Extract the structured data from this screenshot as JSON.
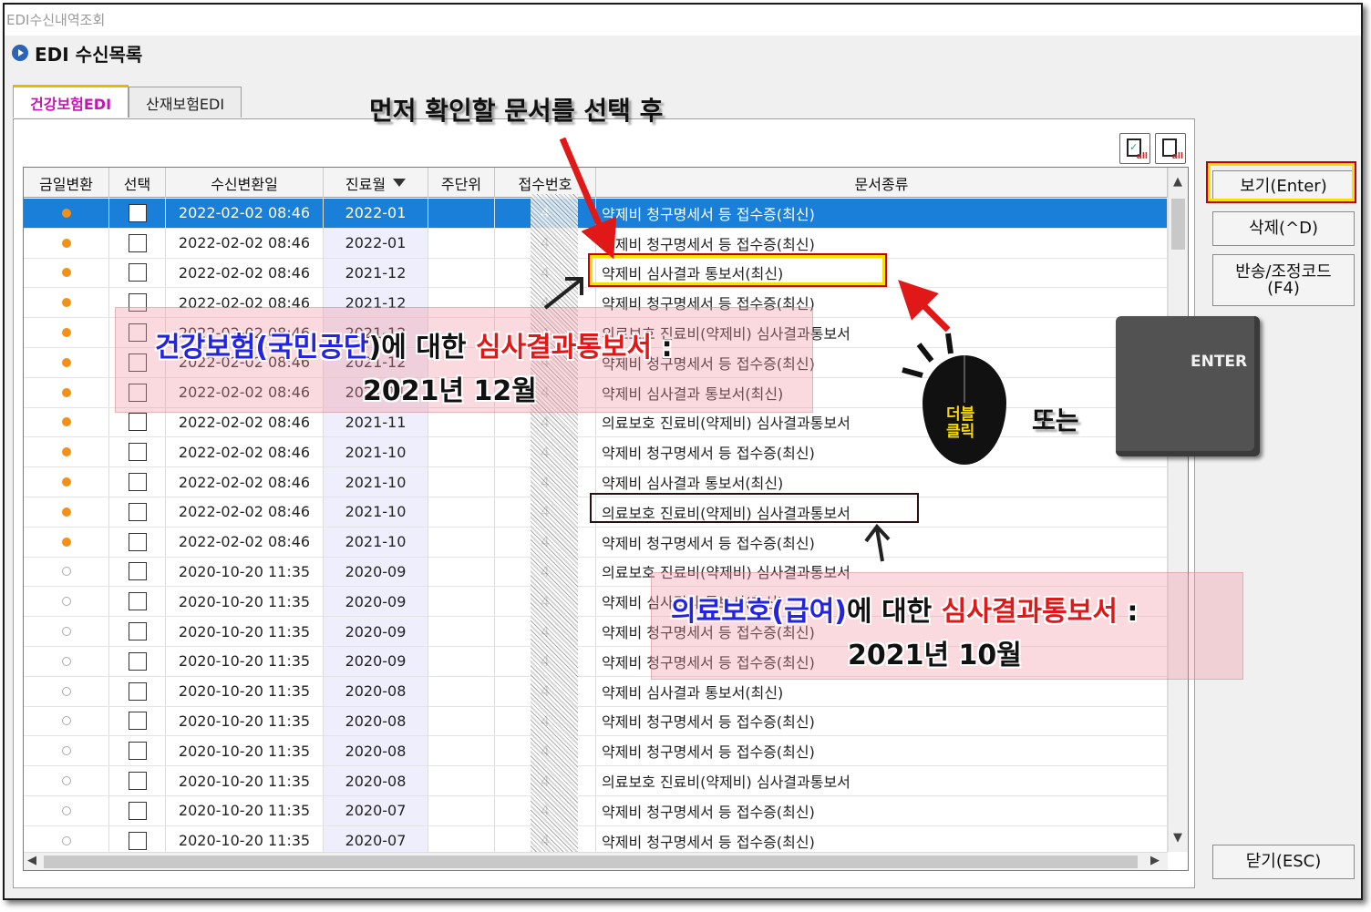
{
  "window": {
    "title": "EDI수신내역조회"
  },
  "section": {
    "title": "EDI 수신목록"
  },
  "tabs": [
    {
      "label": "건강보험EDI",
      "active": true
    },
    {
      "label": "산재보험EDI",
      "active": false
    }
  ],
  "toolbar_icons": [
    "select-all-icon",
    "deselect-all-icon"
  ],
  "grid": {
    "columns": [
      "금일변환",
      "선택",
      "수신변환일",
      "진료월",
      "주단위",
      "접수번호",
      "문서종류"
    ],
    "sort_column": "진료월",
    "rows": [
      {
        "today": true,
        "date": "2022-02-02 08:46",
        "month": "2022-01",
        "receipt": "4",
        "doc": "약제비 청구명세서 등 접수증(최신)"
      },
      {
        "today": true,
        "date": "2022-02-02 08:46",
        "month": "2022-01",
        "receipt": "4",
        "doc": "약제비 청구명세서 등 접수증(최신)"
      },
      {
        "today": true,
        "date": "2022-02-02 08:46",
        "month": "2021-12",
        "receipt": "4",
        "doc": "약제비 심사결과 통보서(최신)"
      },
      {
        "today": true,
        "date": "2022-02-02 08:46",
        "month": "2021-12",
        "receipt": "4",
        "doc": "약제비 청구명세서 등 접수증(최신)"
      },
      {
        "today": true,
        "date": "2022-02-02 08:46",
        "month": "2021-12",
        "receipt": "4",
        "doc": "의료보호 진료비(약제비) 심사결과통보서"
      },
      {
        "today": true,
        "date": "2022-02-02 08:46",
        "month": "2021-12",
        "receipt": "4",
        "doc": "약제비 청구명세서 등 접수증(최신)"
      },
      {
        "today": true,
        "date": "2022-02-02 08:46",
        "month": "2021-11",
        "receipt": "4",
        "doc": "약제비 심사결과 통보서(최신)"
      },
      {
        "today": true,
        "date": "2022-02-02 08:46",
        "month": "2021-11",
        "receipt": "4",
        "doc": "의료보호 진료비(약제비) 심사결과통보서"
      },
      {
        "today": true,
        "date": "2022-02-02 08:46",
        "month": "2021-10",
        "receipt": "4",
        "doc": "약제비 청구명세서 등 접수증(최신)"
      },
      {
        "today": true,
        "date": "2022-02-02 08:46",
        "month": "2021-10",
        "receipt": "4",
        "doc": "약제비 심사결과 통보서(최신)"
      },
      {
        "today": true,
        "date": "2022-02-02 08:46",
        "month": "2021-10",
        "receipt": "4",
        "doc": "의료보호 진료비(약제비) 심사결과통보서"
      },
      {
        "today": true,
        "date": "2022-02-02 08:46",
        "month": "2021-10",
        "receipt": "4",
        "doc": "약제비 청구명세서 등 접수증(최신)"
      },
      {
        "today": false,
        "date": "2020-10-20 11:35",
        "month": "2020-09",
        "receipt": "4",
        "doc": "의료보호 진료비(약제비) 심사결과통보서"
      },
      {
        "today": false,
        "date": "2020-10-20 11:35",
        "month": "2020-09",
        "receipt": "4",
        "doc": "약제비 심사결과 통보서(최신)"
      },
      {
        "today": false,
        "date": "2020-10-20 11:35",
        "month": "2020-09",
        "receipt": "4",
        "doc": "약제비 청구명세서 등 접수증(최신)"
      },
      {
        "today": false,
        "date": "2020-10-20 11:35",
        "month": "2020-09",
        "receipt": "4",
        "doc": "약제비 청구명세서 등 접수증(최신)"
      },
      {
        "today": false,
        "date": "2020-10-20 11:35",
        "month": "2020-08",
        "receipt": "4",
        "doc": "약제비 심사결과 통보서(최신)"
      },
      {
        "today": false,
        "date": "2020-10-20 11:35",
        "month": "2020-08",
        "receipt": "4",
        "doc": "약제비 청구명세서 등 접수증(최신)"
      },
      {
        "today": false,
        "date": "2020-10-20 11:35",
        "month": "2020-08",
        "receipt": "4",
        "doc": "약제비 청구명세서 등 접수증(최신)"
      },
      {
        "today": false,
        "date": "2020-10-20 11:35",
        "month": "2020-08",
        "receipt": "4",
        "doc": "의료보호 진료비(약제비) 심사결과통보서"
      },
      {
        "today": false,
        "date": "2020-10-20 11:35",
        "month": "2020-07",
        "receipt": "4",
        "doc": "약제비 청구명세서 등 접수증(최신)"
      },
      {
        "today": false,
        "date": "2020-10-20 11:35",
        "month": "2020-07",
        "receipt": "4",
        "doc": "약제비 청구명세서 등 접수증(최신)"
      }
    ]
  },
  "buttons": {
    "view": "보기(Enter)",
    "delete": "삭제(^D)",
    "return_code_line1": "반송/조정코드",
    "return_code_line2": "(F4)",
    "close": "닫기(ESC)"
  },
  "annotations": {
    "instruction": "먼저 확인할 문서를 선택 후",
    "note1": {
      "pre": "건강보험(",
      "blue": "국민공단",
      "mid": ")에 대한 ",
      "red": "심사결과통보서",
      "post": " :",
      "line2": "2021년 12월"
    },
    "note2": {
      "blue": "의료보호(급여)",
      "mid": "에 대한 ",
      "red": "심사결과통보서",
      "post": " :",
      "line2": "2021년 10월"
    },
    "or_text": "또는",
    "mouse_label_1": "더블",
    "mouse_label_2": "클릭",
    "enter_key_label": "ENTER"
  },
  "colors": {
    "accent": "#1a7fd8",
    "today_dot": "#f39018",
    "tab_active": "#c516b4",
    "highlight": "#f5e100",
    "arrow": "#e01818"
  }
}
